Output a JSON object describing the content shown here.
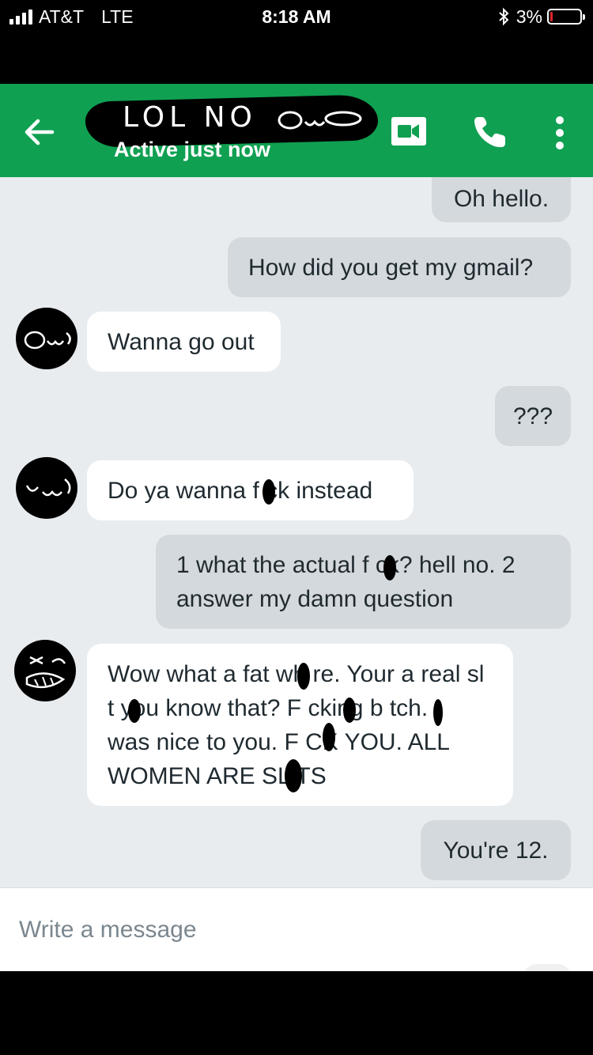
{
  "status_bar": {
    "carrier": "AT&T",
    "network": "LTE",
    "time": "8:18 AM",
    "battery": "3%",
    "battery_level": 0.03,
    "battery_color": "#e0242a"
  },
  "header": {
    "contact_name": "LOL NO",
    "status": "Active just now",
    "background_color": "#10a052",
    "icons": [
      "back-arrow-icon",
      "video-camera-icon",
      "phone-icon",
      "more-vertical-icon"
    ]
  },
  "messages": [
    {
      "direction": "outgoing",
      "text": "Oh hello."
    },
    {
      "direction": "outgoing",
      "text": "How did you get my gmail?"
    },
    {
      "direction": "incoming",
      "text": "Wanna go out"
    },
    {
      "direction": "outgoing",
      "text": "???"
    },
    {
      "direction": "incoming",
      "text": "Do ya wanna f ck instead"
    },
    {
      "direction": "outgoing",
      "text": "1 what the actual f ck? hell no. 2 answer my damn question"
    },
    {
      "direction": "incoming",
      "text": "Wow what a fat wh re. Your a real sl t you know that? F cking b tch. I was nice to you. F CK YOU. ALL WOMEN ARE SL TS"
    },
    {
      "direction": "outgoing",
      "text": "You're 12."
    }
  ],
  "composer": {
    "placeholder": "Write a message"
  },
  "colors": {
    "chat_background": "#e9ecef",
    "outgoing_bubble": "#d4d9dd",
    "incoming_bubble": "#ffffff"
  }
}
